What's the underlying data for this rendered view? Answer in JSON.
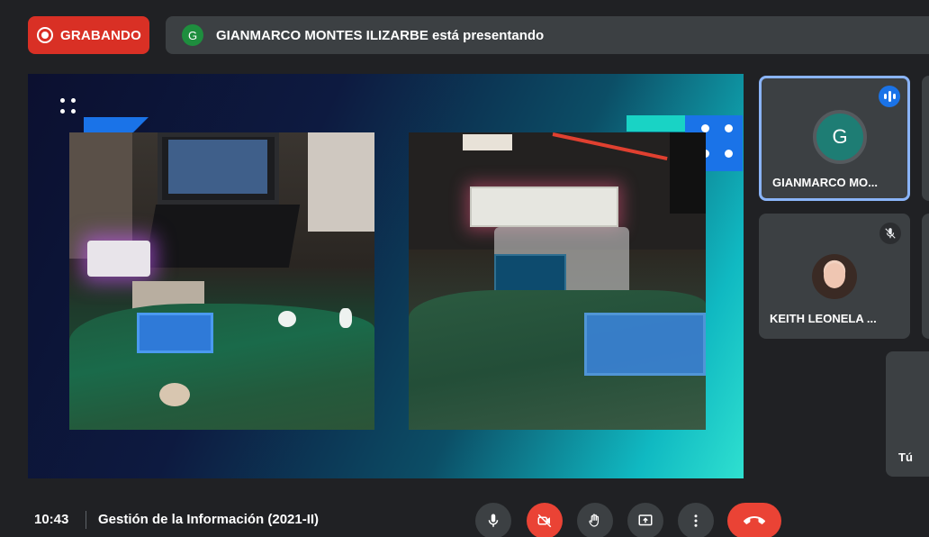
{
  "recording": {
    "label": "GRABANDO"
  },
  "presenter_bar": {
    "avatar_letter": "G",
    "text": "GIANMARCO MONTES ILIZARBE está presentando"
  },
  "participants": [
    {
      "name": "GIANMARCO MO...",
      "avatar_letter": "G",
      "status": "speaking-icon",
      "avatar_color": "#1e7d74"
    },
    {
      "name": "KEITH LEONELA ...",
      "status": "mic-off-icon"
    },
    {
      "name": "Tú"
    }
  ],
  "bottom_bar": {
    "time": "10:43",
    "meeting_title": "Gestión de la Información (2021-II)",
    "controls": [
      "mic-icon",
      "camera-off-icon",
      "raise-hand-icon",
      "present-screen-icon",
      "more-options-icon",
      "end-call-icon"
    ]
  },
  "colors": {
    "recording_red": "#d93025",
    "active_speaker_border": "#8ab4f8",
    "accent_blue": "#1a73e8",
    "end_call_red": "#ea4335"
  }
}
